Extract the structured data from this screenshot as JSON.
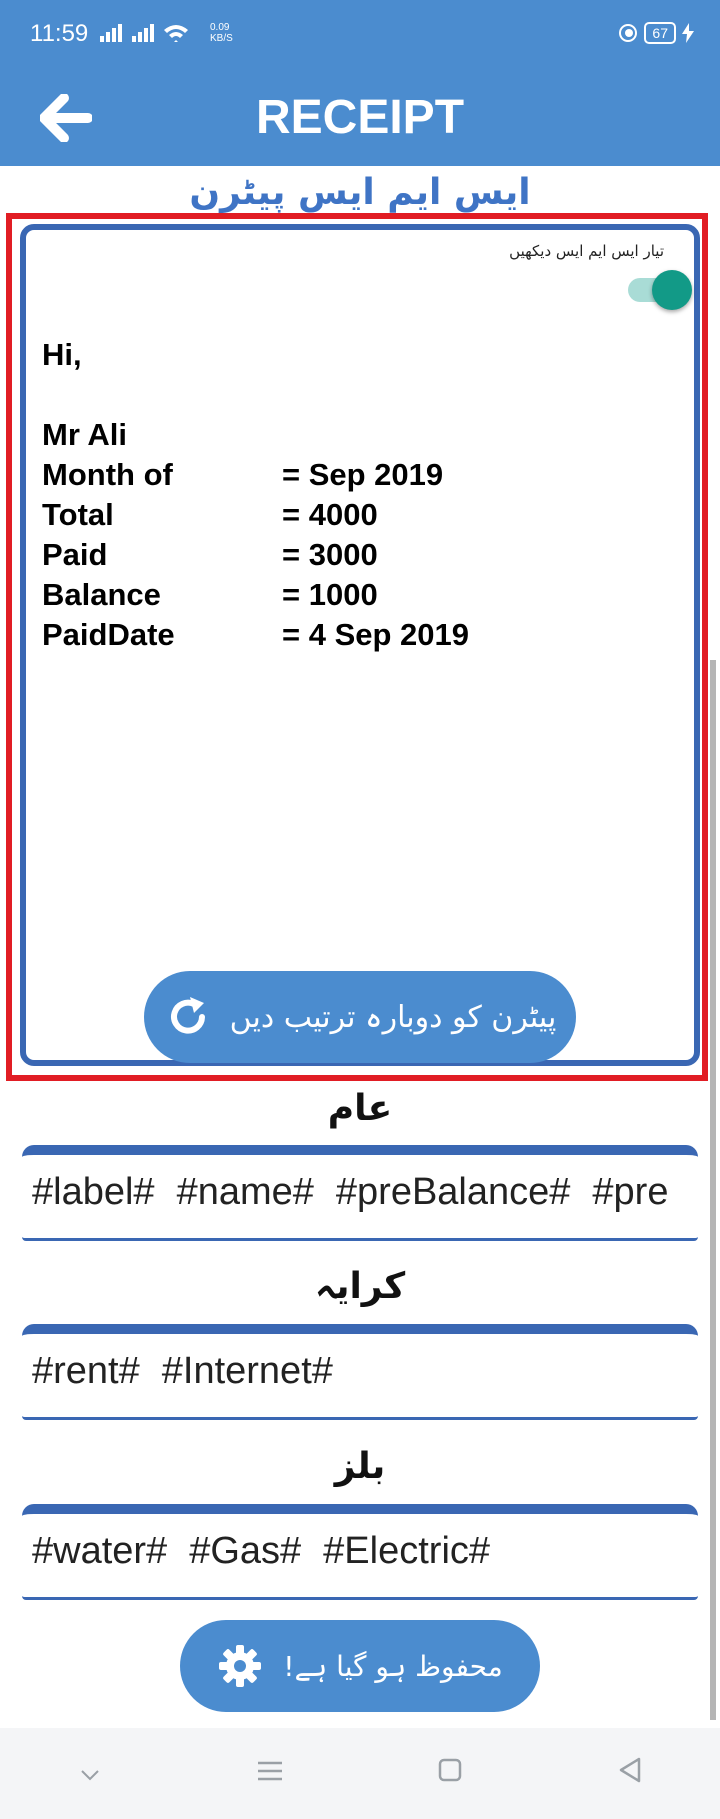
{
  "status_bar": {
    "time": "11:59",
    "network_speed": "0.09",
    "network_unit": "KB/S",
    "battery": "67",
    "signal_icons": "signal-icon",
    "wifi_icon": "wifi-icon"
  },
  "app_bar": {
    "title": "RECEIPT",
    "back_icon": "arrow-left-icon",
    "color": "#4b8ccf"
  },
  "heading": "ایس ایم ایس پیٹرن",
  "preview": {
    "toggle_label": "تیار ایس ایم ایس دیکھیں",
    "toggle_on": true,
    "greeting": "Hi,",
    "name": "Mr Ali",
    "rows": [
      {
        "label": "Month of",
        "value": "= Sep 2019"
      },
      {
        "label": "Total",
        "value": "= 4000"
      },
      {
        "label": "Paid",
        "value": "= 3000"
      },
      {
        "label": "Balance",
        "value": "= 1000"
      },
      {
        "label": "PaidDate",
        "value": "= 4 Sep 2019"
      }
    ],
    "reset_button": "پیٹرن کو دوبارہ ترتیب دیں",
    "reset_icon": "refresh-icon"
  },
  "sections": [
    {
      "title": "عام",
      "tags": [
        "#label#",
        "#name#",
        "#preBalance#",
        "#pre"
      ]
    },
    {
      "title": "کرایہ",
      "tags": [
        "#rent#",
        "#Internet#"
      ]
    },
    {
      "title": "بلز",
      "tags": [
        "#water#",
        "#Gas#",
        "#Electric#"
      ]
    }
  ],
  "save_button": {
    "label": "محفوظ ہو گیا ہے!",
    "icon": "gear-icon"
  },
  "nav": [
    "chevron-down-icon",
    "menu-icon",
    "home-square-icon",
    "back-triangle-icon"
  ],
  "colors": {
    "accent": "#4b8ccf",
    "card_border": "#3a67b3",
    "highlight": "#e11d24",
    "toggle": "#129a87"
  }
}
